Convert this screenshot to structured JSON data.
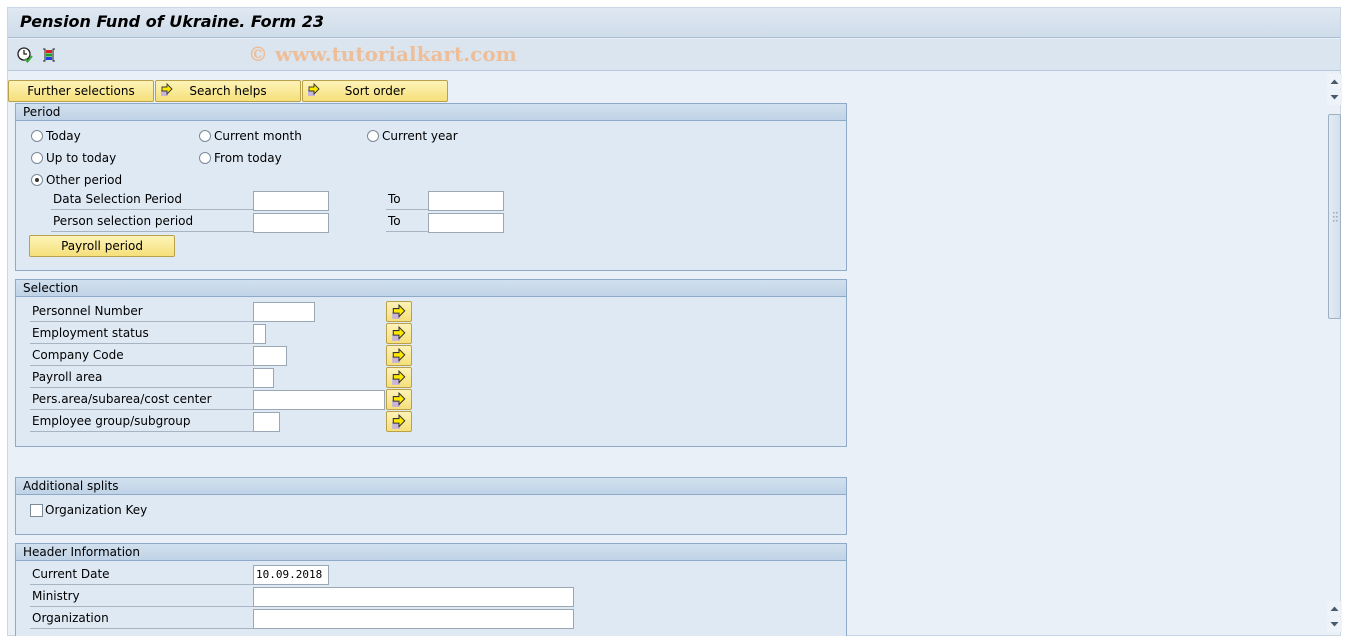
{
  "window": {
    "title": "Pension Fund of Ukraine. Form 23"
  },
  "toolbar": {
    "execute_icon": "execute-clock-icon",
    "variant_icon": "get-variant-icon",
    "watermark": "© www.tutorialkart.com"
  },
  "buttons": {
    "further_selections": "Further selections",
    "search_helps": "Search helps",
    "sort_order": "Sort order"
  },
  "period": {
    "title": "Period",
    "radios": [
      {
        "label": "Today",
        "selected": false
      },
      {
        "label": "Current month",
        "selected": false
      },
      {
        "label": "Current year",
        "selected": false
      },
      {
        "label": "Up to today",
        "selected": false
      },
      {
        "label": "From today",
        "selected": false
      },
      {
        "label": "Other period",
        "selected": true
      }
    ],
    "data_selection_label": "Data Selection Period",
    "person_selection_label": "Person selection period",
    "to_label": "To",
    "data_from": "",
    "data_to": "",
    "person_from": "",
    "person_to": "",
    "payroll_button": "Payroll period"
  },
  "selection": {
    "title": "Selection",
    "fields": [
      {
        "label": "Personnel Number",
        "value": ""
      },
      {
        "label": "Employment status",
        "value": ""
      },
      {
        "label": "Company Code",
        "value": ""
      },
      {
        "label": "Payroll area",
        "value": ""
      },
      {
        "label": "Pers.area/subarea/cost center",
        "value": ""
      },
      {
        "label": "Employee group/subgroup",
        "value": ""
      }
    ]
  },
  "additional_splits": {
    "title": "Additional splits",
    "org_key_label": "Organization Key",
    "org_key_checked": false
  },
  "header_info": {
    "title": "Header Information",
    "current_date_label": "Current Date",
    "current_date_value": "10.09.2018",
    "ministry_label": "Ministry",
    "ministry_value": "",
    "organization_label": "Organization",
    "organization_value": ""
  }
}
